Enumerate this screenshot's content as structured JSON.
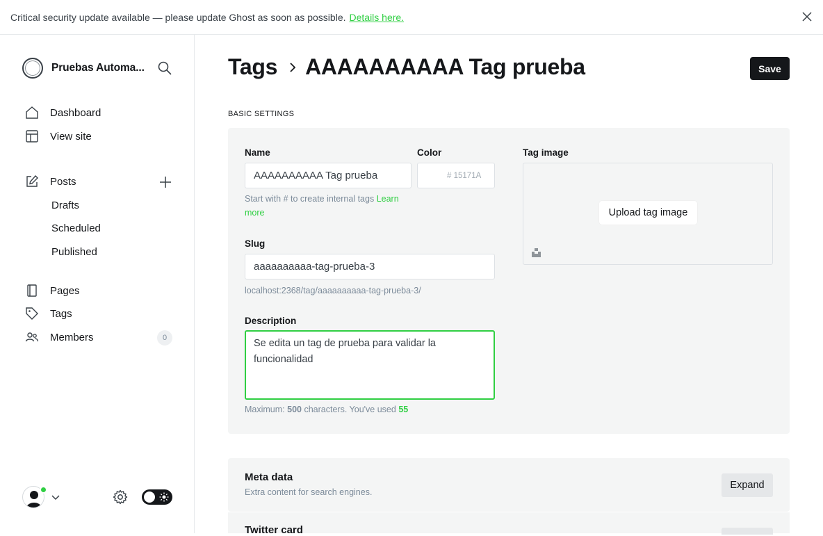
{
  "banner": {
    "message": "Critical security update available — please update Ghost as soon as possible.",
    "link": "Details here."
  },
  "sidebar": {
    "site_title": "Pruebas Automa...",
    "nav": {
      "dashboard": "Dashboard",
      "view_site": "View site",
      "posts": "Posts",
      "drafts": "Drafts",
      "scheduled": "Scheduled",
      "published": "Published",
      "pages": "Pages",
      "tags": "Tags",
      "members": "Members",
      "members_count": "0"
    }
  },
  "header": {
    "breadcrumb_parent": "Tags",
    "breadcrumb_current": "AAAAAAAAAA Tag prueba",
    "save_label": "Save"
  },
  "basic_settings": {
    "section_label": "BASIC SETTINGS",
    "name_label": "Name",
    "name_value": "AAAAAAAAAA Tag prueba",
    "name_hint": "Start with # to create internal tags",
    "name_hint_link": "Learn more",
    "color_label": "Color",
    "color_hash": "#",
    "color_placeholder": "15171A",
    "slug_label": "Slug",
    "slug_value": "aaaaaaaaaa-tag-prueba-3",
    "slug_url": "localhost:2368/tag/aaaaaaaaaa-tag-prueba-3/",
    "description_label": "Description",
    "description_value": "Se edita un tag de prueba para validar la funcionalidad",
    "desc_hint_prefix": "Maximum:",
    "desc_max": "500",
    "desc_hint_mid": "characters. You've used",
    "desc_used": "55",
    "image_label": "Tag image",
    "upload_label": "Upload tag image"
  },
  "meta_card": {
    "title": "Meta data",
    "subtitle": "Extra content for search engines.",
    "expand_label": "Expand"
  },
  "twitter_card": {
    "title": "Twitter card"
  },
  "colors": {
    "accent": "#30cf43",
    "dark": "#15171a",
    "panel": "#f4f5f5"
  }
}
